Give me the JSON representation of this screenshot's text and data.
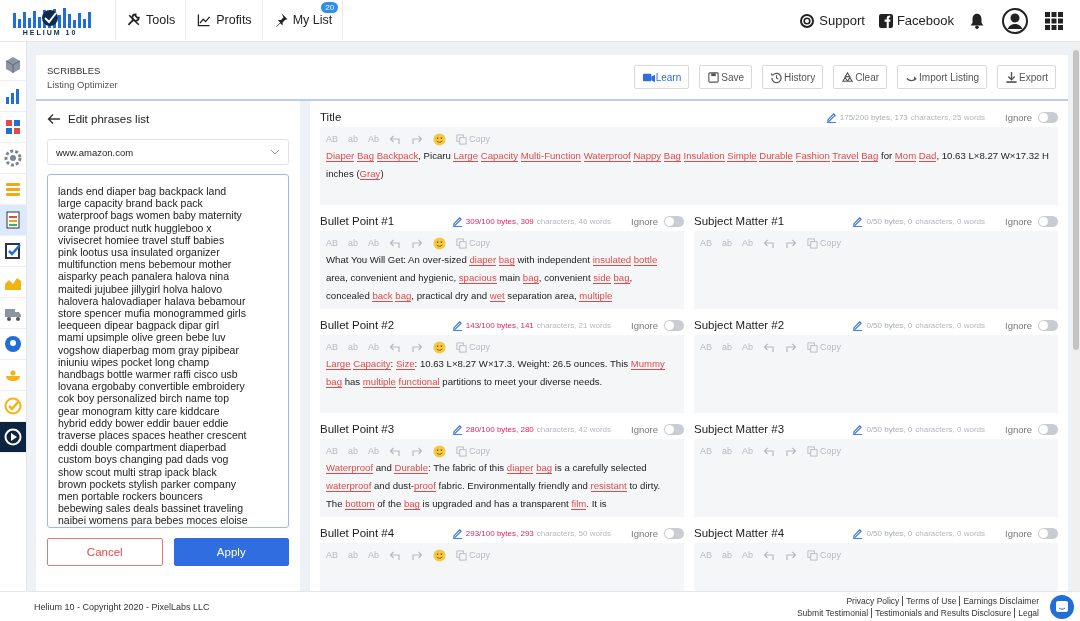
{
  "topbar": {
    "logo": "HELIUM 10",
    "nav": [
      {
        "label": "Tools",
        "selected": false
      },
      {
        "label": "Profits",
        "selected": false
      },
      {
        "label": "My List",
        "selected": false,
        "badge": "20"
      }
    ],
    "links": [
      "Support",
      "Facebook"
    ]
  },
  "sidebar": {
    "items": [
      {
        "selected": false,
        "highlighted": false
      },
      {
        "selected": false,
        "highlighted": false
      },
      {
        "selected": false,
        "highlighted": false
      },
      {
        "selected": false,
        "highlighted": false
      },
      {
        "selected": false,
        "highlighted": false
      },
      {
        "selected": false,
        "highlighted": true
      },
      {
        "selected": false,
        "highlighted": false
      },
      {
        "selected": false,
        "highlighted": false
      },
      {
        "selected": false,
        "highlighted": false
      },
      {
        "selected": false,
        "highlighted": false
      },
      {
        "selected": false,
        "highlighted": false
      },
      {
        "selected": false,
        "highlighted": false
      },
      {
        "selected": true,
        "highlighted": false
      }
    ]
  },
  "header": {
    "title": "SCRIBBLES",
    "subtitle": "Listing Optimizer",
    "buttons": [
      {
        "label": "Learn",
        "primary": true
      },
      {
        "label": "Save",
        "primary": false
      },
      {
        "label": "History",
        "primary": false
      },
      {
        "label": "Clear",
        "primary": false
      },
      {
        "label": "Import Listing",
        "primary": false
      },
      {
        "label": "Export",
        "primary": false
      }
    ]
  },
  "phrases_panel": {
    "back_label": "Edit phrases list",
    "marketplace": "www.amazon.com",
    "phrases": [
      "lands end diaper bag backpack land",
      "large capacity brand back pack",
      "waterproof bags women baby maternity",
      "orange product nutk huggleboo x",
      "vivisecret homiee travel stuff babies",
      "pink lootus usa insulated organizer",
      "multifunction mens bebemour mother",
      "aisparky peach panalera halova nina",
      "maitedi jujubee jillygirl holva halovo",
      "halovera halovadiaper halava bebamour",
      "store spencer mufia monogrammed girls",
      "leequeen dipear bagpack dipar girl",
      "mami upsimple olive green bebe luv",
      "vogshow diaperbag mom gray pipibear",
      "iniuniu wipes pocket long champ",
      "handbags bottle warmer raffi cisco usb",
      "lovana ergobaby convertible embroidery",
      "cok boy personalized birch name top",
      "gear monogram kitty care kiddcare",
      "hybrid eddy bower eddir bauer eddie",
      "traverse places spaces heather crescent",
      "eddi double compartment diaperbad",
      "custom boys changing pad dads vog",
      "show scout multi strap ipack black",
      "brown pockets stylish parker company",
      "men portable rockers bouncers",
      "bebewing sales deals bassinet traveling",
      "naibei womens para bebes moces eloise"
    ],
    "cancel": "Cancel",
    "apply": "Apply"
  },
  "editors": [
    {
      "kind": "title",
      "label": "Title",
      "stats_lead": "175/200 bytes, 173",
      "stats_tail": "characters, 25 words",
      "over_limit": false,
      "ignore_label": "Ignore",
      "ignored": false,
      "toolbar": {
        "case_buttons": [
          "AB",
          "ab",
          "Ab"
        ],
        "emoji": true,
        "copy": "Copy"
      },
      "segments": [
        {
          "text": "Diaper",
          "keyword": true
        },
        {
          "text": "Bag",
          "keyword": true
        },
        {
          "text": "Backpack",
          "keyword": true
        },
        {
          "text": ", Picaru ",
          "keyword": false
        },
        {
          "text": "Large",
          "keyword": true
        },
        {
          "text": "Capacity",
          "keyword": true
        },
        {
          "text": "Multi-Function",
          "keyword": true
        },
        {
          "text": "Waterproof",
          "keyword": true
        },
        {
          "text": "Nappy",
          "keyword": true
        },
        {
          "text": "Bag",
          "keyword": true
        },
        {
          "text": "Insulation",
          "keyword": true
        },
        {
          "text": "Simple",
          "keyword": true
        },
        {
          "text": "Durable",
          "keyword": true
        },
        {
          "text": "Fashion",
          "keyword": true
        },
        {
          "text": "Travel",
          "keyword": true
        },
        {
          "text": "Bag",
          "keyword": true
        },
        {
          "text": " for ",
          "keyword": false
        },
        {
          "text": "Mom",
          "keyword": true
        },
        {
          "text": "Dad",
          "keyword": true
        },
        {
          "text": ", 10.63 L×8.27 W×17.32 H inches (",
          "keyword": false
        },
        {
          "text": "Gray",
          "keyword": true
        },
        {
          "text": ")",
          "keyword": false
        }
      ]
    },
    {
      "kind": "bullet",
      "label": "Bullet Point #1",
      "stats_lead": "309/100 bytes, 309",
      "stats_tail": "characters, 46 words",
      "over_limit": true,
      "ignore_label": "Ignore",
      "ignored": false,
      "toolbar": {
        "case_buttons": [
          "AB",
          "ab",
          "Ab"
        ],
        "emoji": true,
        "copy": "Copy"
      },
      "segments": [
        {
          "text": "What You Will Get: An over-sized ",
          "keyword": false
        },
        {
          "text": "diaper",
          "keyword": true
        },
        {
          "text": "bag",
          "keyword": true
        },
        {
          "text": " with independent ",
          "keyword": false
        },
        {
          "text": "insulated",
          "keyword": true
        },
        {
          "text": "bottle",
          "keyword": true
        },
        {
          "text": " area, convenient and hygienic, ",
          "keyword": false
        },
        {
          "text": "spacious",
          "keyword": true
        },
        {
          "text": " main ",
          "keyword": false
        },
        {
          "text": "bag",
          "keyword": true
        },
        {
          "text": ", convenient ",
          "keyword": false
        },
        {
          "text": "side",
          "keyword": true
        },
        {
          "text": "bag",
          "keyword": true
        },
        {
          "text": ", concealed ",
          "keyword": false
        },
        {
          "text": "back",
          "keyword": true
        },
        {
          "text": "bag",
          "keyword": true
        },
        {
          "text": ", practical dry and ",
          "keyword": false
        },
        {
          "text": "wet",
          "keyword": true
        },
        {
          "text": " separation area, ",
          "keyword": false
        },
        {
          "text": "multiple",
          "keyword": true
        }
      ]
    },
    {
      "kind": "subject",
      "label": "Subject Matter #1",
      "stats_lead": "0/50 bytes, 0",
      "stats_tail": "characters, 0 words",
      "over_limit": false,
      "ignore_label": "Ignore",
      "ignored": false,
      "toolbar": {
        "case_buttons": [
          "AB",
          "ab",
          "Ab"
        ],
        "emoji": false,
        "copy": "Copy"
      }
    },
    {
      "kind": "bullet",
      "label": "Bullet Point #2",
      "stats_lead": "143/100 bytes, 141",
      "stats_tail": "characters, 21 words",
      "over_limit": true,
      "ignore_label": "Ignore",
      "ignored": false,
      "toolbar": {
        "case_buttons": [
          "AB",
          "ab",
          "Ab"
        ],
        "emoji": true,
        "copy": "Copy"
      },
      "segments": [
        {
          "text": "Large",
          "keyword": true
        },
        {
          "text": "Capacity",
          "keyword": true
        },
        {
          "text": ": ",
          "keyword": false
        },
        {
          "text": "Size",
          "keyword": true
        },
        {
          "text": ": 10.63 L×8.27 W×17.3. Weight: 26.5 ounces. This ",
          "keyword": false
        },
        {
          "text": "Mummy",
          "keyword": true
        },
        {
          "text": "bag",
          "keyword": true
        },
        {
          "text": " has ",
          "keyword": false
        },
        {
          "text": "multiple",
          "keyword": true
        },
        {
          "text": "functional",
          "keyword": true
        },
        {
          "text": " partitions to meet your diverse needs.",
          "keyword": false
        }
      ]
    },
    {
      "kind": "subject",
      "label": "Subject Matter #2",
      "stats_lead": "0/50 bytes, 0",
      "stats_tail": "characters, 0 words",
      "over_limit": false,
      "ignore_label": "Ignore",
      "ignored": false,
      "toolbar": {
        "case_buttons": [
          "AB",
          "ab",
          "Ab"
        ],
        "emoji": false,
        "copy": "Copy"
      }
    },
    {
      "kind": "bullet",
      "label": "Bullet Point #3",
      "stats_lead": "280/100 bytes, 280",
      "stats_tail": "characters, 42 words",
      "over_limit": true,
      "ignore_label": "Ignore",
      "ignored": false,
      "toolbar": {
        "case_buttons": [
          "AB",
          "ab",
          "Ab"
        ],
        "emoji": true,
        "copy": "Copy"
      },
      "segments": [
        {
          "text": "Waterproof",
          "keyword": true
        },
        {
          "text": " and ",
          "keyword": false
        },
        {
          "text": "Durable",
          "keyword": true
        },
        {
          "text": ": The fabric of this ",
          "keyword": false
        },
        {
          "text": "diaper",
          "keyword": true
        },
        {
          "text": "bag",
          "keyword": true
        },
        {
          "text": " is a carefully selected ",
          "keyword": false
        },
        {
          "text": "waterproof",
          "keyword": true
        },
        {
          "text": " and dust-",
          "keyword": false
        },
        {
          "text": "proof",
          "keyword": true
        },
        {
          "text": " fabric. Environmentally friendly and ",
          "keyword": false
        },
        {
          "text": "resistant",
          "keyword": true
        },
        {
          "text": " to dirty. The ",
          "keyword": false
        },
        {
          "text": "bottom",
          "keyword": true
        },
        {
          "text": " of the ",
          "keyword": false
        },
        {
          "text": "bag",
          "keyword": true
        },
        {
          "text": " is upgraded and has a transparent ",
          "keyword": false
        },
        {
          "text": "film",
          "keyword": true
        },
        {
          "text": ". It is",
          "keyword": false
        }
      ]
    },
    {
      "kind": "subject",
      "label": "Subject Matter #3",
      "stats_lead": "0/50 bytes, 0",
      "stats_tail": "characters, 0 words",
      "over_limit": false,
      "ignore_label": "Ignore",
      "ignored": false,
      "toolbar": {
        "case_buttons": [
          "AB",
          "ab",
          "Ab"
        ],
        "emoji": false,
        "copy": "Copy"
      }
    },
    {
      "kind": "bullet",
      "label": "Bullet Point #4",
      "stats_lead": "293/100 bytes, 293",
      "stats_tail": "characters, 50 words",
      "over_limit": true,
      "ignore_label": "Ignore",
      "ignored": false,
      "toolbar": {
        "case_buttons": [
          "AB",
          "ab",
          "Ab"
        ],
        "emoji": true,
        "copy": "Copy"
      }
    },
    {
      "kind": "subject",
      "label": "Subject Matter #4",
      "stats_lead": "0/50 bytes, 0",
      "stats_tail": "characters, 0 words",
      "over_limit": false,
      "ignore_label": "Ignore",
      "ignored": false,
      "toolbar": {
        "case_buttons": [
          "AB",
          "ab",
          "Ab"
        ],
        "emoji": false,
        "copy": "Copy"
      }
    }
  ],
  "footer": {
    "copyright": "Helium 10 - Copyright 2020 - PixelLabs LLC",
    "link_rows": [
      [
        "Privacy Policy",
        "Terms of Use",
        "Earnings Disclaimer"
      ],
      [
        "Submit Testimonial",
        "Testimonials and Results Disclosure",
        "Legal"
      ]
    ]
  }
}
